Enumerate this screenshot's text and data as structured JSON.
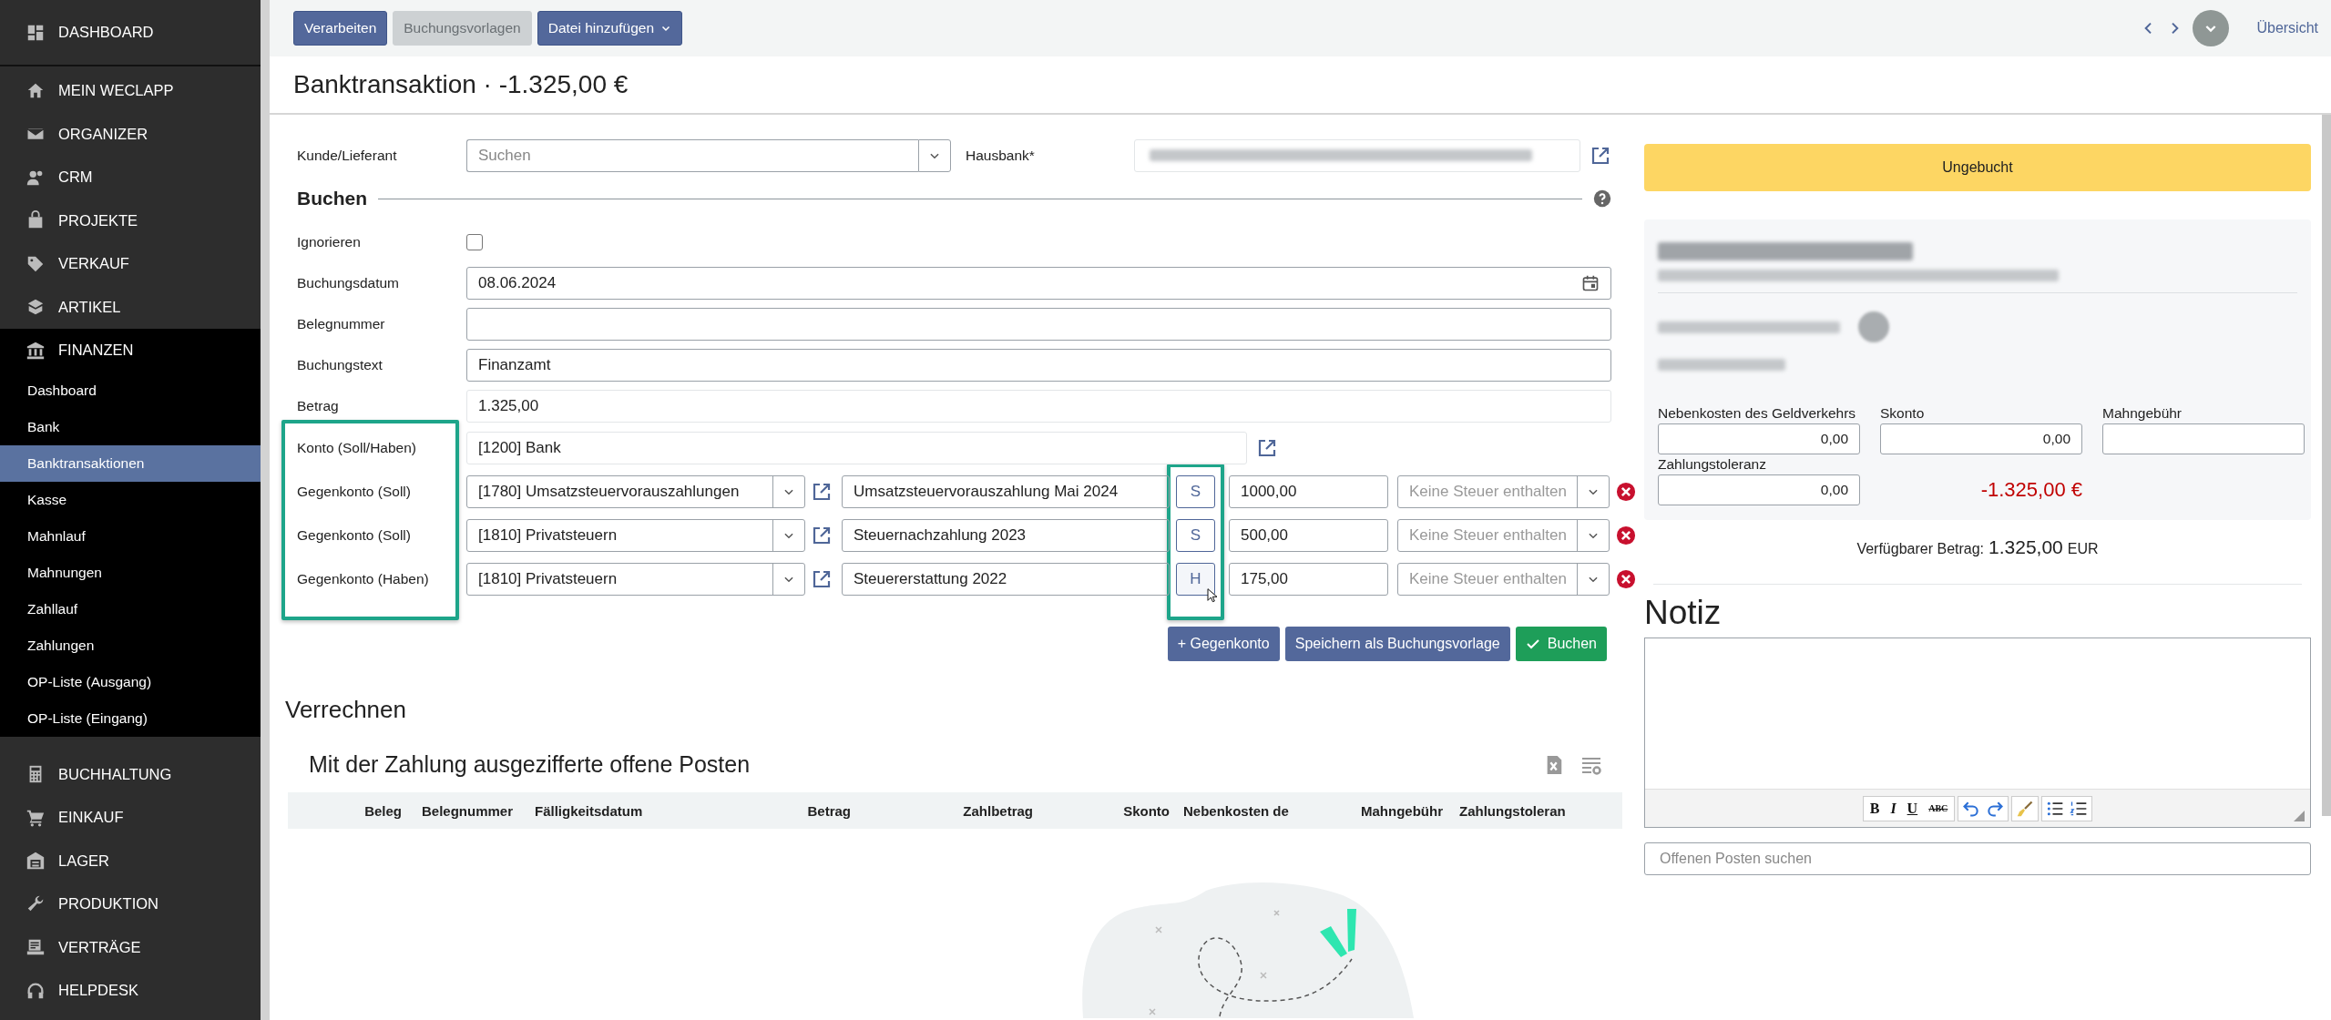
{
  "sidebar": {
    "items": [
      {
        "label": "DASHBOARD",
        "selected": false,
        "expanded": false
      },
      {
        "label": "MEIN WECLAPP",
        "selected": false,
        "expanded": false
      },
      {
        "label": "ORGANIZER",
        "selected": false,
        "expanded": false
      },
      {
        "label": "CRM",
        "selected": false,
        "expanded": false
      },
      {
        "label": "PROJEKTE",
        "selected": false,
        "expanded": false
      },
      {
        "label": "VERKAUF",
        "selected": false,
        "expanded": false
      },
      {
        "label": "ARTIKEL",
        "selected": false,
        "expanded": false
      },
      {
        "label": "FINANZEN",
        "selected": false,
        "expanded": true,
        "children": [
          {
            "label": "Dashboard",
            "selected": false
          },
          {
            "label": "Bank",
            "selected": false
          },
          {
            "label": "Banktransaktionen",
            "selected": true
          },
          {
            "label": "Kasse",
            "selected": false
          },
          {
            "label": "Mahnlauf",
            "selected": false
          },
          {
            "label": "Mahnungen",
            "selected": false
          },
          {
            "label": "Zahllauf",
            "selected": false
          },
          {
            "label": "Zahlungen",
            "selected": false
          },
          {
            "label": "OP-Liste (Ausgang)",
            "selected": false
          },
          {
            "label": "OP-Liste (Eingang)",
            "selected": false
          }
        ]
      },
      {
        "label": "BUCHHALTUNG",
        "selected": false,
        "expanded": false
      },
      {
        "label": "EINKAUF",
        "selected": false,
        "expanded": false
      },
      {
        "label": "LAGER",
        "selected": false,
        "expanded": false
      },
      {
        "label": "PRODUKTION",
        "selected": false,
        "expanded": false
      },
      {
        "label": "VERTRÄGE",
        "selected": false,
        "expanded": false
      },
      {
        "label": "HELPDESK",
        "selected": false,
        "expanded": false
      }
    ]
  },
  "toolbar": {
    "buttons": [
      {
        "label": "Verarbeiten",
        "disabled": false,
        "kind": "button"
      },
      {
        "label": "Buchungsvorlagen",
        "disabled": true,
        "kind": "button"
      },
      {
        "label": "Datei hinzufügen",
        "disabled": false,
        "kind": "dropdown"
      }
    ],
    "overview_link": "Übersicht"
  },
  "title": "Banktransaktion · -1.325,00 €",
  "header_fields": {
    "customer": {
      "label": "Kunde/Lieferant",
      "placeholder": "Suchen"
    },
    "house_bank": {
      "label": "Hausbank*"
    }
  },
  "section_title": "Buchen",
  "ignore": {
    "label": "Ignorieren",
    "checked": false
  },
  "fields": [
    {
      "label": "Buchungsdatum",
      "value": "08.06.2024",
      "kind": "date"
    },
    {
      "label": "Belegnummer",
      "kind": "text"
    },
    {
      "label": "Buchungstext",
      "value": "Finanzamt",
      "kind": "text"
    },
    {
      "label": "Betrag",
      "value": "1.325,00",
      "kind": "readonly"
    }
  ],
  "account": {
    "label": "Konto (Soll/Haben)",
    "value": "[1200] Bank"
  },
  "counter_accounts": [
    {
      "label": "Gegenkonto (Soll)",
      "account": "[1780] Umsatzsteuervorauszahlungen",
      "text": "Umsatzsteuervorauszahlung Mai 2024",
      "side": "S",
      "amount": "1000,00",
      "tax_placeholder": "Keine Steuer enthalten",
      "hovered": false
    },
    {
      "label": "Gegenkonto (Soll)",
      "account": "[1810] Privatsteuern",
      "text": "Steuernachzahlung 2023",
      "side": "S",
      "amount": "500,00",
      "tax_placeholder": "Keine Steuer enthalten",
      "hovered": false
    },
    {
      "label": "Gegenkonto (Haben)",
      "account": "[1810] Privatsteuern",
      "text": "Steuererstattung 2022",
      "side": "H",
      "amount": "175,00",
      "tax_placeholder": "Keine Steuer enthalten",
      "hovered": true
    }
  ],
  "actions": [
    {
      "label": "+ Gegenkonto",
      "kind": "secondary"
    },
    {
      "label": "Speichern als Buchungsvorlage",
      "kind": "secondary"
    },
    {
      "label": "Buchen",
      "kind": "primary"
    }
  ],
  "settle": {
    "title": "Verrechnen",
    "table_title": "Mit der Zahlung ausgezifferte offene Posten",
    "columns": [
      {
        "label": "Beleg"
      },
      {
        "label": "Belegnummer"
      },
      {
        "label": "Fälligkeitsdatum"
      },
      {
        "label": "Betrag"
      },
      {
        "label": "Zahlbetrag"
      },
      {
        "label": "Skonto"
      },
      {
        "label": "Nebenkosten de"
      },
      {
        "label": "Mahngebühr"
      },
      {
        "label": "Zahlungstoleran"
      }
    ]
  },
  "status": {
    "label": "Ungebucht"
  },
  "fees": [
    {
      "label": "Nebenkosten des Geldverkehrs",
      "value": "0,00"
    },
    {
      "label": "Skonto",
      "value": "0,00"
    },
    {
      "label": "Mahngebühr"
    },
    {
      "label": "Zahlungstoleranz",
      "value": "0,00"
    }
  ],
  "difference": "-1.325,00 €",
  "available": {
    "label": "Verfügbarer Betrag:",
    "amount": "1.325,00",
    "currency": "EUR"
  },
  "note": {
    "title": "Notiz",
    "format_buttons": [
      "B",
      "I",
      "U",
      "ABC"
    ]
  },
  "search": {
    "placeholder": "Offenen Posten suchen"
  }
}
